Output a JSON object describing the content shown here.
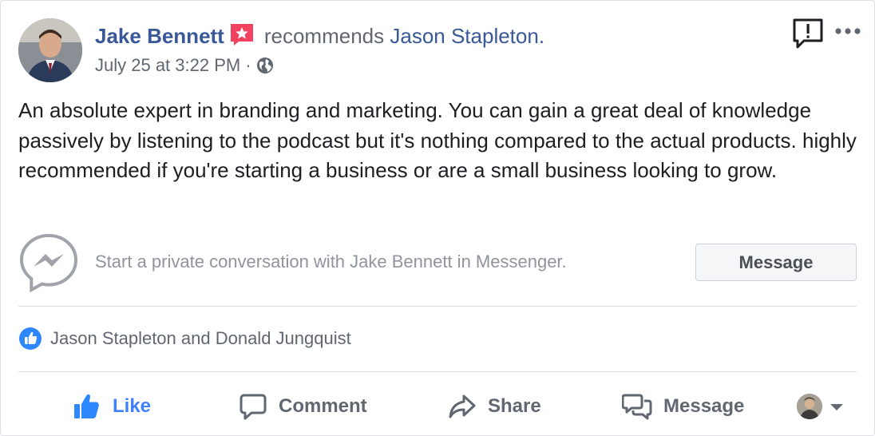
{
  "post": {
    "author": "Jake Bennett",
    "action_text": "recommends",
    "page_name": "Jason Stapleton.",
    "timestamp": "July 25 at 3:22 PM",
    "separator": "·",
    "body": "An absolute expert in branding and marketing. You can gain a great deal of knowledge passively by listening to the podcast but it's nothing compared to the actual products. highly recommended if you're starting a business or are a small business looking to grow."
  },
  "messenger": {
    "prompt": "Start a private conversation with Jake Bennett in Messenger.",
    "button_label": "Message"
  },
  "reactions": {
    "names": "Jason Stapleton and Donald Jungquist"
  },
  "actions": {
    "like": "Like",
    "comment": "Comment",
    "share": "Share",
    "message": "Message"
  },
  "colors": {
    "link_blue": "#385898",
    "like_blue": "#2d88ff",
    "recommend_badge": "#f3425f",
    "muted_text": "#606770"
  },
  "icons": [
    "avatar",
    "recommend-star-badge",
    "globe-icon",
    "report-icon",
    "more-options-icon",
    "messenger-icon",
    "like-thumb-icon",
    "comment-icon",
    "share-icon",
    "message-icon",
    "caret-down-icon"
  ]
}
